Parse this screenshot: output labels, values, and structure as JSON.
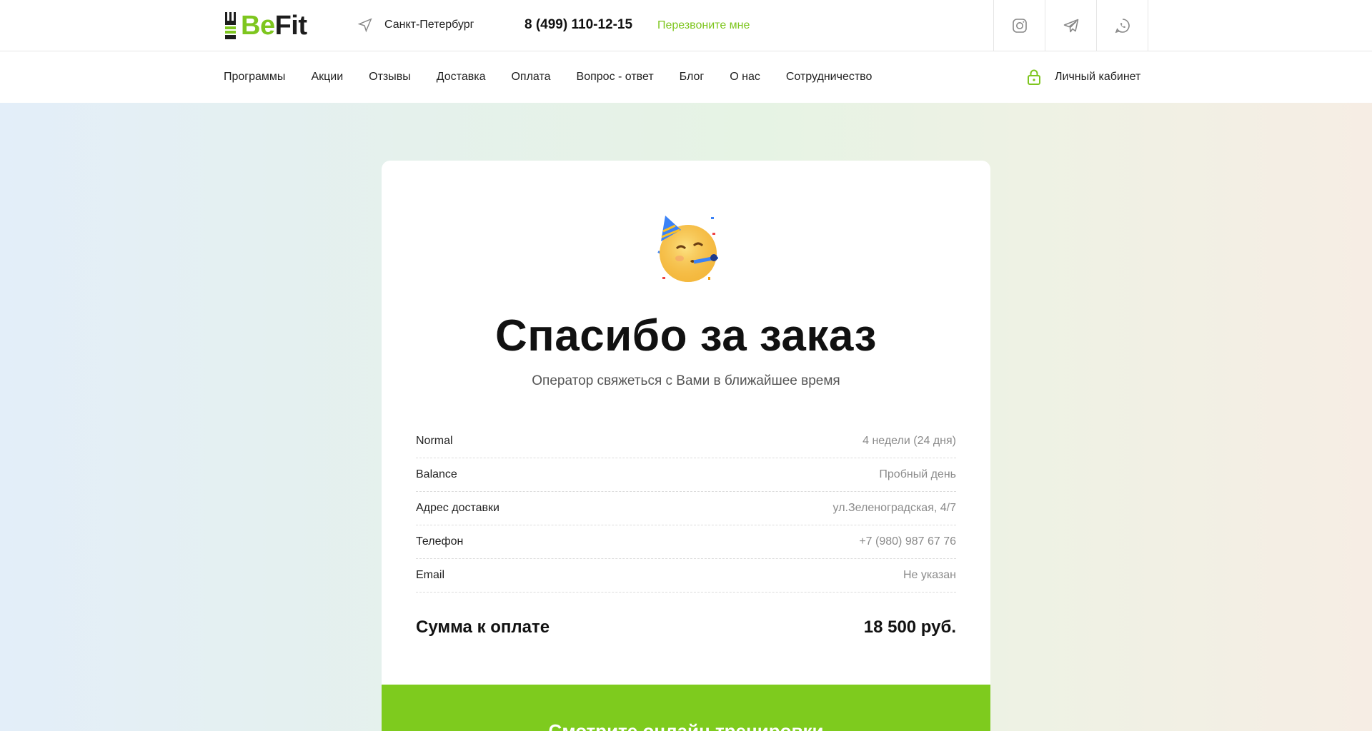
{
  "header": {
    "logo": {
      "be": "Be",
      "fit": "Fit"
    },
    "city": "Санкт-Петербург",
    "phone": "8 (499) 110-12-15",
    "callback": "Перезвоните мне",
    "socials": [
      "instagram-icon",
      "telegram-icon",
      "whatsapp-icon"
    ]
  },
  "nav": {
    "items": [
      {
        "label": "Программы"
      },
      {
        "label": "Акции"
      },
      {
        "label": "Отзывы"
      },
      {
        "label": "Доставка"
      },
      {
        "label": "Оплата"
      },
      {
        "label": "Вопрос - ответ"
      },
      {
        "label": "Блог"
      },
      {
        "label": "О нас"
      },
      {
        "label": "Сотрудничество"
      }
    ],
    "account": "Личный кабинет"
  },
  "order": {
    "title": "Спасибо за заказ",
    "subtitle": "Оператор свяжеться с Вами в ближайшее время",
    "rows": [
      {
        "key": "Normal",
        "value": "4 недели (24 дня)"
      },
      {
        "key": "Balance",
        "value": "Пробный день"
      },
      {
        "key": "Адрес доставки",
        "value": "ул.Зеленоградская, 4/7"
      },
      {
        "key": "Телефон",
        "value": "+7 (980) 987 67 76"
      },
      {
        "key": "Email",
        "value": "Не указан"
      }
    ],
    "total_label": "Сумма к оплате",
    "total_value": "18 500 руб.",
    "cta": "Смотрите онлайн тренировки"
  },
  "colors": {
    "accent": "#7ec61f",
    "cta": "#7ecb1e"
  }
}
